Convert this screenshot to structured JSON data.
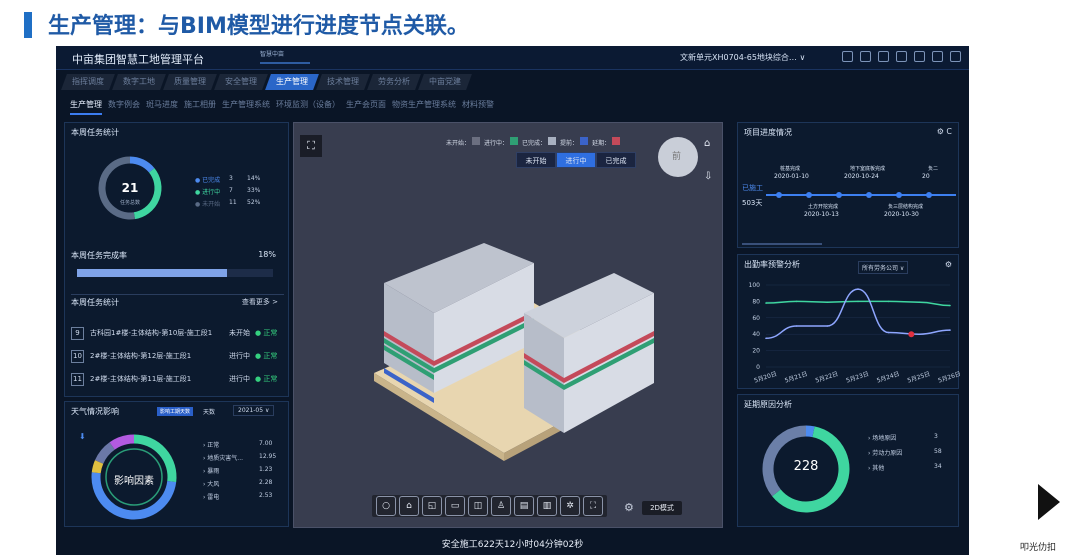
{
  "slide": {
    "title": "生产管理：与BIM模型进行进度节点关联。",
    "corner_mark": "叩光仂扣"
  },
  "app": {
    "title": "中亩集团智慧工地管理平台",
    "weather_chip": "智慧中亩",
    "project_select": "文新单元XH0704-65地块综合… ∨",
    "status_bar": "安全施工622天12小时04分钟02秒"
  },
  "tabs_top": [
    "指挥调度",
    "数字工地",
    "质量管理",
    "安全管理",
    "生产管理",
    "技术管理",
    "劳务分析",
    "中亩党建"
  ],
  "tabs_top_active": "生产管理",
  "tabs_sub": [
    "生产管理",
    "数字例会",
    "斑马进度",
    "施工相册",
    "生产管理系统",
    "环境监测（设备）",
    "生产会页面",
    "物资生产管理系统",
    "材料预警"
  ],
  "tabs_sub_active": "生产管理",
  "task_stats": {
    "title": "本周任务统计",
    "total": "21",
    "total_label": "任务总数",
    "legend": [
      {
        "label": "● 已完成",
        "count": "3",
        "pct": "14%",
        "color": "#4d8bf0",
        "value": 14
      },
      {
        "label": "● 进行中",
        "count": "7",
        "pct": "33%",
        "color": "#3fd6a0",
        "value": 33
      },
      {
        "label": "● 未开始",
        "count": "11",
        "pct": "52%",
        "color": "#5a6b86",
        "value": 52
      }
    ],
    "rate_title": "本周任务完成率",
    "rate_value": "18%",
    "rate": 0.18,
    "list_title": "本周任务统计",
    "list_more": "查看更多 >",
    "rows": [
      {
        "num": "9",
        "text": "古科园1#楼-主体结构-第10层-施工段1",
        "status": "未开始",
        "state": "● 正常"
      },
      {
        "num": "10",
        "text": "2#楼-主体结构-第12层-施工段1",
        "status": "进行中",
        "state": "● 正常"
      },
      {
        "num": "11",
        "text": "2#楼-主体结构-第11层-施工段1",
        "status": "进行中",
        "state": "● 正常"
      }
    ]
  },
  "weather": {
    "title": "天气情况影响",
    "badge": "影响工期天数",
    "badge_unit": "天数",
    "month": "2021-05 ∨",
    "center": "影响因素",
    "legend": [
      {
        "label": "› 正常",
        "value": "7.00",
        "color": "#3fd6a0"
      },
      {
        "label": "› 地质灾害气...",
        "value": "12.95",
        "color": "#4d8bf0"
      },
      {
        "label": "› 暴雨",
        "value": "1.23",
        "color": "#e0c040"
      },
      {
        "label": "› 大风",
        "value": "2.28",
        "color": "#6b78a8"
      },
      {
        "label": "› 雷电",
        "value": "2.53",
        "color": "#b25ae0"
      }
    ]
  },
  "viewport": {
    "legend": [
      {
        "label": "未开始：",
        "color": "#6b6f80"
      },
      {
        "label": "进行中：",
        "color": "#2f9f74"
      },
      {
        "label": "已完成：",
        "color": "#a8b0c0"
      },
      {
        "label": "提前：",
        "color": "#3b63c8"
      },
      {
        "label": "延期：",
        "color": "#c44a5a"
      }
    ],
    "buttons": [
      "未开始",
      "进行中",
      "已完成"
    ],
    "active_button": "进行中",
    "mode_label": "2D模式",
    "cube_label": "前"
  },
  "progress": {
    "title": "项目进度情况",
    "started_label": "已施工",
    "days": "503天",
    "top_nodes": [
      {
        "name": "桩基完成",
        "date": "2020-01-10"
      },
      {
        "name": "地下室底板完成",
        "date": "2020-10-24"
      },
      {
        "name": "负二",
        "date": "20"
      }
    ],
    "bottom_nodes": [
      {
        "name": "土方开挖完成",
        "date": "2020-10-13"
      },
      {
        "name": "负三层结构完成",
        "date": "2020-10-30"
      }
    ]
  },
  "attendance": {
    "title": "出勤率预警分析",
    "filter": "所有劳务公司 ∨",
    "yticks": [
      "100",
      "80",
      "60",
      "40",
      "20",
      "0"
    ],
    "xticks": [
      "5月20日",
      "5月21日",
      "5月22日",
      "5月23日",
      "5月24日",
      "5月25日",
      "5月26日"
    ]
  },
  "delay": {
    "title": "延期原因分析",
    "total": "228",
    "legend": [
      {
        "label": "› 场地原因",
        "value": "3",
        "color": "#4d8bf0"
      },
      {
        "label": "› 劳动力原因",
        "value": "58",
        "color": "#3fd6a0"
      },
      {
        "label": "› 其他",
        "value": "34",
        "color": "#6b7fa8"
      }
    ]
  },
  "chart_data": {
    "type": "line",
    "title": "出勤率预警分析",
    "categories": [
      "5月20日",
      "5月21日",
      "5月22日",
      "5月23日",
      "5月24日",
      "5月25日",
      "5月26日"
    ],
    "ylim": [
      0,
      100
    ],
    "series": [
      {
        "values": [
          78,
          80,
          79,
          80,
          80,
          79,
          75
        ],
        "color": "#3fd6a0"
      },
      {
        "values": [
          35,
          50,
          50,
          95,
          42,
          40,
          45
        ],
        "color": "#8ea6ff"
      }
    ]
  }
}
